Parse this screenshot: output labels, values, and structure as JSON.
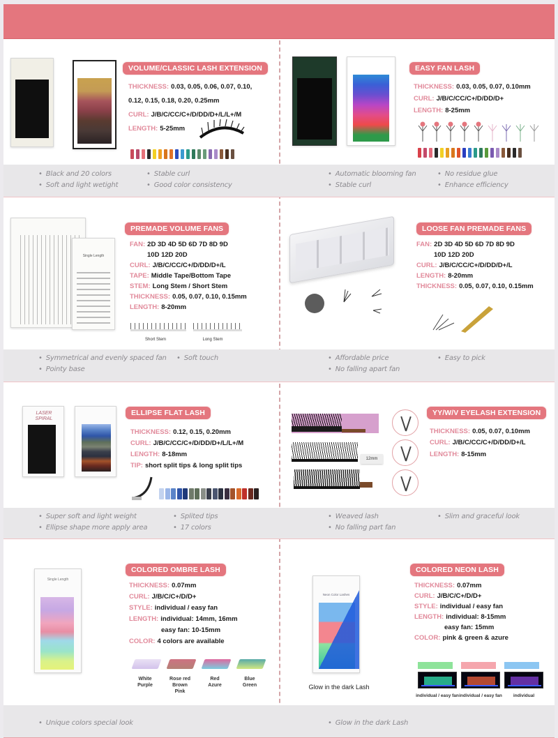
{
  "colors": {
    "accent": "#e4767e",
    "label": "#e1899a",
    "feature_bg": "#e8e7e9",
    "divider": "#d4a5a8"
  },
  "products": [
    {
      "title": "VOLUME/CLASSIC LASH EXTENSION",
      "specs": [
        {
          "k": "THICKNESS:",
          "v": "0.03, 0.05, 0.06, 0.07, 0.10,"
        },
        {
          "k": "",
          "v": "0.12, 0.15, 0.18, 0.20, 0.25mm"
        },
        {
          "k": "CURL:",
          "v": "J/B/C/CC/C+/D/DD/D+/L/L+/M"
        },
        {
          "k": "LENGTH:",
          "v": "5-25mm"
        }
      ],
      "features": [
        [
          "Black and 20 colors",
          "Soft and light wetight"
        ],
        [
          "Stable curl",
          "Good color consistency"
        ]
      ]
    },
    {
      "title": "EASY FAN LASH",
      "specs": [
        {
          "k": "THICKNESS:",
          "v": "0.03, 0.05, 0.07, 0.10mm"
        },
        {
          "k": "CURL:",
          "v": "J/B/C/CC/C+/D/DD/D+"
        },
        {
          "k": "LENGTH:",
          "v": "8-25mm"
        }
      ],
      "features": [
        [
          "Automatic blooming fan",
          "Stable curl"
        ],
        [
          "No residue glue",
          "Enhance efficiency"
        ]
      ]
    },
    {
      "title": "PREMADE VOLUME FANS",
      "specs": [
        {
          "k": "FAN:",
          "v": "2D 3D 4D 5D 6D 7D 8D 9D"
        },
        {
          "k": "",
          "v": "10D 12D 20D",
          "cont": true
        },
        {
          "k": "CURL:",
          "v": "J/B/C/CC/C+/D/DD/D+/L"
        },
        {
          "k": "TAPE:",
          "v": "Middle Tape/Bottom Tape"
        },
        {
          "k": "STEM:",
          "v": "Long Stem / Short Stem"
        },
        {
          "k": "THICKNESS:",
          "v": "0.05, 0.07, 0.10, 0.15mm"
        },
        {
          "k": "LENGTH:",
          "v": "8-20mm"
        }
      ],
      "captions": [
        "Short Stem",
        "Long Stem"
      ],
      "box_label": "Single Length",
      "features": [
        [
          "Symmetrical and evenly spaced fan",
          "Pointy base"
        ],
        [
          "Soft touch"
        ]
      ]
    },
    {
      "title": "LOOSE FAN PREMADE FANS",
      "specs": [
        {
          "k": "FAN:",
          "v": "2D 3D 4D 5D 6D 7D 8D 9D"
        },
        {
          "k": "",
          "v": "10D 12D 20D",
          "cont": true
        },
        {
          "k": "CURL:",
          "v": "J/B/C/CC/C+/D/DD/D+/L"
        },
        {
          "k": "LENGTH:",
          "v": "8-20mm"
        },
        {
          "k": "THICKNESS:",
          "v": "0.05, 0.07, 0.10, 0.15mm"
        }
      ],
      "features": [
        [
          "Affordable price",
          "No falling apart fan"
        ],
        [
          "Easy to pick"
        ]
      ]
    },
    {
      "title": "ELLIPSE FLAT LASH",
      "specs": [
        {
          "k": "THICKNESS:",
          "v": "0.12, 0.15, 0.20mm"
        },
        {
          "k": "CURL:",
          "v": "J/B/C/CC/C+/D/DD/D+/L/L+/M"
        },
        {
          "k": "LENGTH:",
          "v": "8-18mm"
        },
        {
          "k": "TIP:",
          "v": "short split tips & long split tips"
        }
      ],
      "box_label": "LASER SPIRAL",
      "features": [
        [
          "Super soft and light weight",
          "Ellipse shape more apply area"
        ],
        [
          "Splited tips",
          "17 colors"
        ]
      ]
    },
    {
      "title": "YY/W/V EYELASH EXTENSION",
      "specs": [
        {
          "k": "THICKNESS:",
          "v": "0.05, 0.07, 0.10mm"
        },
        {
          "k": "CURL:",
          "v": "J/B/C/CC/C+/D/DD/D+/L"
        },
        {
          "k": "LENGTH:",
          "v": "8-15mm"
        }
      ],
      "strip_label": "12mm",
      "features": [
        [
          "Weaved lash",
          "No falling part fan"
        ],
        [
          "Slim and graceful look"
        ]
      ]
    },
    {
      "title": "COLORED OMBRE  LASH",
      "specs": [
        {
          "k": "THICKNESS:",
          "v": "0.07mm"
        },
        {
          "k": "CURL:",
          "v": "J/B/C/C+/D/D+"
        },
        {
          "k": "STYLE:",
          "v": "individual / easy fan"
        },
        {
          "k": "LENGTH:",
          "v": "individual: 14mm, 16mm"
        },
        {
          "k": "",
          "v": "easy fan: 10-15mm",
          "cont2": true
        },
        {
          "k": "COLOR:",
          "v": "4 colors are available"
        }
      ],
      "box_label": "Single Length",
      "swatches": [
        {
          "label": "White\nPurple",
          "colors": [
            "#e6dcf3",
            "#cbb8e8"
          ]
        },
        {
          "label": "Rose red\nBrown\nPink",
          "colors": [
            "#c55a6c",
            "#a86a5e"
          ]
        },
        {
          "label": "Red\nAzure",
          "colors": [
            "#d94f8e",
            "#63c3d9"
          ]
        },
        {
          "label": "Blue\nGreen",
          "colors": [
            "#3a9b9a",
            "#c9e36a"
          ]
        }
      ],
      "features": [
        [
          "Unique colors special look"
        ]
      ]
    },
    {
      "title": "COLORED NEON LASH",
      "specs": [
        {
          "k": "THICKNESS:",
          "v": "0.07mm"
        },
        {
          "k": "CURL:",
          "v": "J/B/C/C+/D/D+"
        },
        {
          "k": "STYLE:",
          "v": "individual / easy fan"
        },
        {
          "k": "LENGTH:",
          "v": "individual: 8-15mm"
        },
        {
          "k": "",
          "v": "easy fan: 15mm",
          "cont2": true
        },
        {
          "k": "COLOR:",
          "v": "pink & green & azure"
        }
      ],
      "box_label": "Neon Color Lashes",
      "glow_caption": "Glow in the dark Lash",
      "neon_captions": [
        "individual / easy fan",
        "individual / easy fan",
        "individual"
      ],
      "features": [
        [
          "Glow in the dark Lash"
        ]
      ]
    }
  ]
}
